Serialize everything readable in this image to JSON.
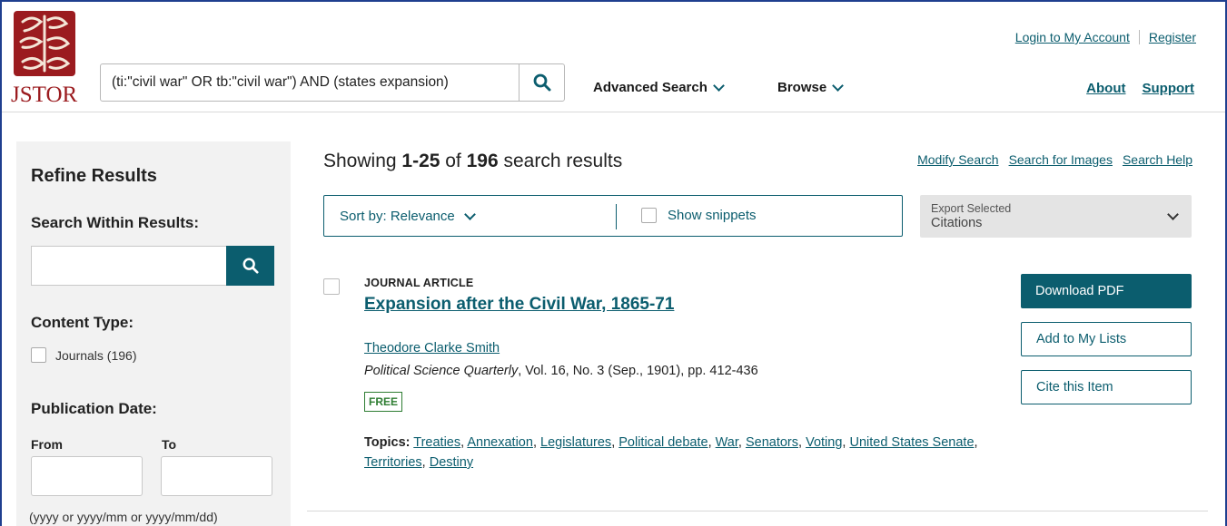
{
  "header": {
    "logo_text": "JSTOR",
    "query": "(ti:\"civil war\" OR tb:\"civil war\") AND (states expansion)",
    "advanced_search": "Advanced Search",
    "browse": "Browse",
    "login": "Login to My Account",
    "register": "Register",
    "about": "About",
    "support": "Support"
  },
  "sidebar": {
    "title": "Refine Results",
    "search_within": "Search Within Results:",
    "content_type": "Content Type:",
    "journals_option": "Journals (196)",
    "pub_date": "Publication Date:",
    "from": "From",
    "to": "To",
    "date_hint": "(yyyy or yyyy/mm or yyyy/mm/dd)"
  },
  "results": {
    "prefix": "Showing ",
    "range": "1-25",
    "of": " of ",
    "total": "196",
    "suffix": " search results",
    "links": [
      "Modify Search",
      "Search for Images",
      "Search Help"
    ],
    "sort_label": "Sort by: Relevance",
    "show_snippets": "Show snippets",
    "export_line1": "Export Selected",
    "export_line2": "Citations"
  },
  "item": {
    "type": "JOURNAL ARTICLE",
    "title": "Expansion after the Civil War, 1865-71",
    "author": "Theodore Clarke Smith",
    "journal": "Political Science Quarterly",
    "details": ", Vol. 16, No. 3 (Sep., 1901), pp. 412-436",
    "badge": "FREE",
    "topics_label": "Topics:",
    "topics": [
      "Treaties",
      "Annexation",
      "Legislatures",
      "Political debate",
      "War",
      "Senators",
      "Voting",
      "United States Senate",
      "Territories",
      "Destiny"
    ],
    "download": "Download PDF",
    "add_lists": "Add to My Lists",
    "cite": "Cite this Item"
  },
  "colors": {
    "brand_teal": "#0b5d6e",
    "jstor_red": "#9b1b1f",
    "free_green": "#2e7d32"
  }
}
